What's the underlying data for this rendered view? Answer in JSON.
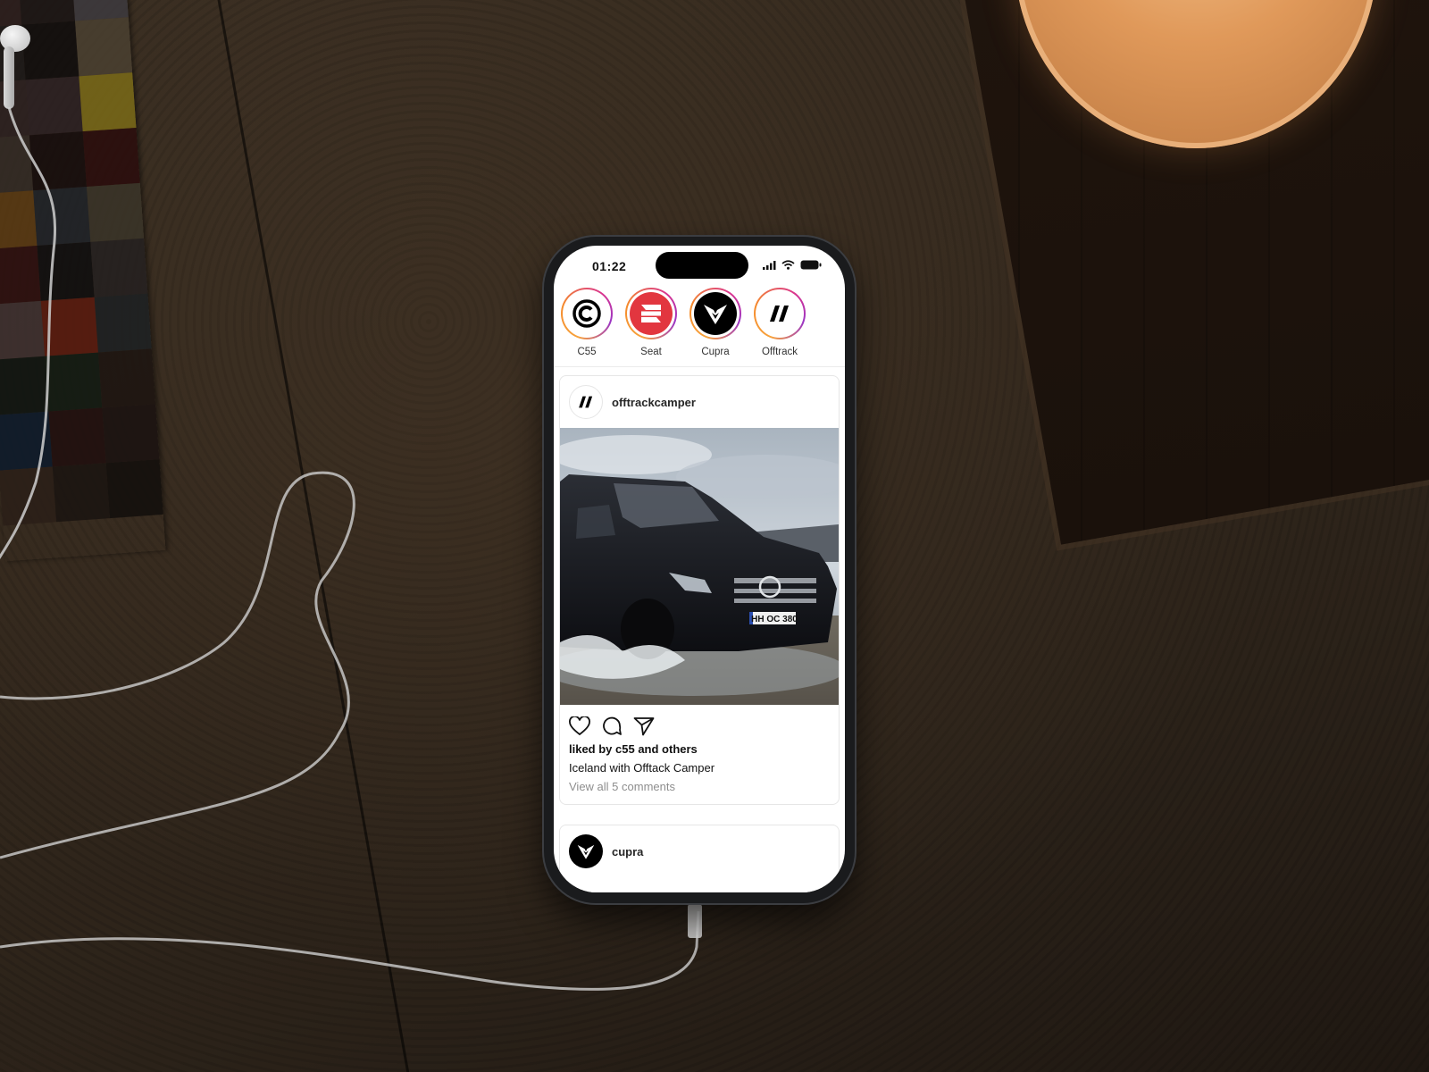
{
  "status_bar": {
    "time": "01:22",
    "icons": [
      "cellular-signal-icon",
      "wifi-icon",
      "battery-icon"
    ]
  },
  "stories": [
    {
      "label": "C55",
      "icon": "c55-copyright-logo",
      "avatar_bg": "#ffffff",
      "glyph_color": "#000000"
    },
    {
      "label": "Seat",
      "icon": "seat-s-logo",
      "avatar_bg": "#e2363f",
      "glyph_color": "#ffffff"
    },
    {
      "label": "Cupra",
      "icon": "cupra-logo",
      "avatar_bg": "#000000",
      "glyph_color": "#ffffff"
    },
    {
      "label": "Offtrack",
      "icon": "offtrack-slashes-logo",
      "avatar_bg": "#ffffff",
      "glyph_color": "#000000"
    }
  ],
  "feed": {
    "posts": [
      {
        "username": "offtrackcamper",
        "avatar_icon": "offtrack-slashes-logo",
        "image_alt": "Black Mercedes camper van splashing through water in Iceland",
        "license_plate": "HH OC 380",
        "actions": [
          "heart-icon",
          "comment-icon",
          "share-icon"
        ],
        "likes_text": "liked by c55 and others",
        "caption": "Iceland with Offtack Camper",
        "comments_link": "View all 5 comments"
      },
      {
        "username": "cupra",
        "avatar_icon": "cupra-logo"
      }
    ]
  },
  "colors": {
    "story_ring_start": "#f7a23b",
    "story_ring_end": "#9b35c5",
    "seat_red": "#e2363f",
    "muted_text": "#8e8e8e"
  }
}
